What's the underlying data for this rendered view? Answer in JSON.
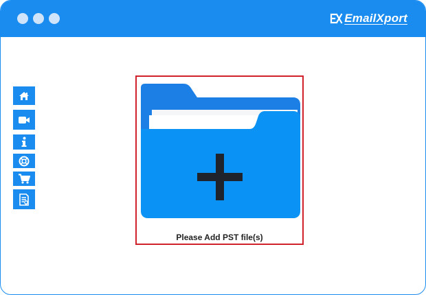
{
  "app": {
    "brand": "EmailXport",
    "accent_color": "#1a8cf0",
    "window_controls": [
      "dot",
      "dot",
      "dot"
    ]
  },
  "sidebar": {
    "items": [
      {
        "icon": "home-icon"
      },
      {
        "icon": "video-camera-icon"
      },
      {
        "icon": "info-icon"
      },
      {
        "icon": "lifebuoy-support-icon"
      },
      {
        "icon": "shopping-cart-icon"
      },
      {
        "icon": "license-document-icon"
      }
    ]
  },
  "dropzone": {
    "label": "Please Add PST file(s)",
    "icon": "folder-add-icon",
    "border_color": "#d0202a"
  }
}
